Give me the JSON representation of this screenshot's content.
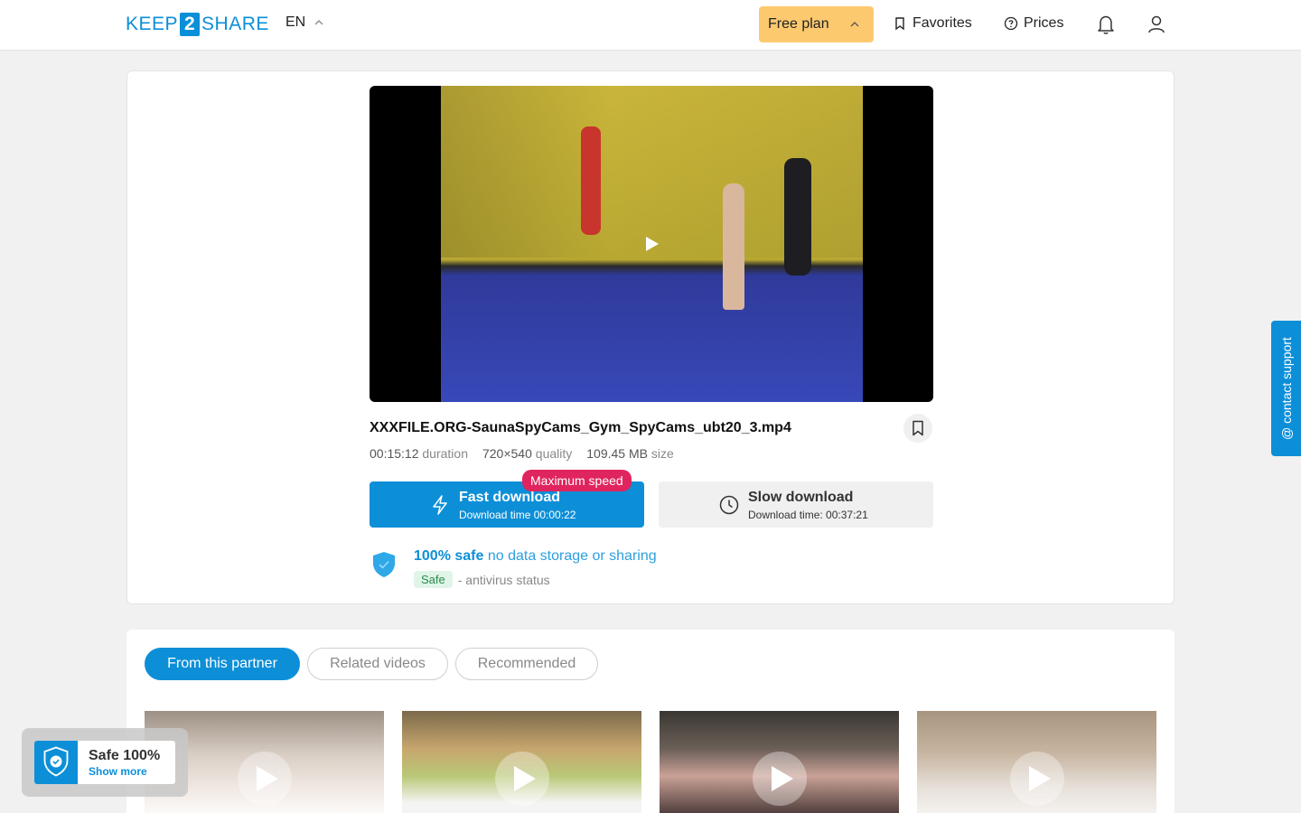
{
  "header": {
    "logo_left": "KEEP",
    "logo_mid": "2",
    "logo_right": "SHARE",
    "language": "EN",
    "plan_label": "Free plan",
    "favorites_label": "Favorites",
    "prices_label": "Prices"
  },
  "file": {
    "title": "XXXFILE.ORG-SaunaSpyCams_Gym_SpyCams_ubt20_3.mp4",
    "duration_value": "00:15:12",
    "duration_label": "duration",
    "quality_value": "720×540",
    "quality_label": "quality",
    "size_value": "109.45 MB",
    "size_label": "size"
  },
  "downloads": {
    "fast_title": "Fast download",
    "fast_time": "Download time 00:00:22",
    "max_speed_badge": "Maximum speed",
    "slow_title": "Slow download",
    "slow_time": "Download time: 00:37:21"
  },
  "safety": {
    "strong": "100% safe",
    "soft": "no data storage or sharing",
    "tag": "Safe",
    "antivirus": "- antivirus status"
  },
  "tabs": [
    {
      "label": "From this partner",
      "active": true
    },
    {
      "label": "Related videos",
      "active": false
    },
    {
      "label": "Recommended",
      "active": false
    }
  ],
  "support_label": "@ contact support",
  "safe_widget": {
    "title": "Safe 100%",
    "link": "Show more"
  },
  "colors": {
    "accent": "#0d8fd8",
    "plan": "#fdc96f",
    "badge": "#e0245e"
  }
}
